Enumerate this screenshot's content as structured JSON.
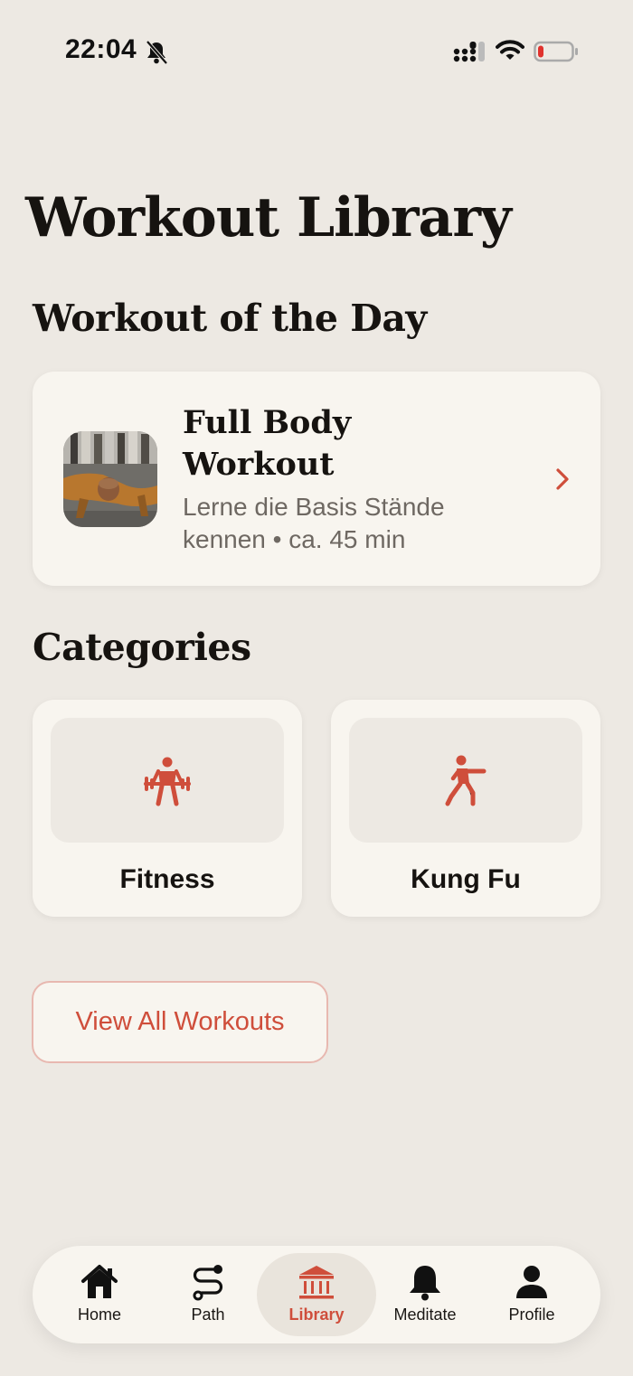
{
  "status_bar": {
    "time": "22:04"
  },
  "page": {
    "title": "Workout Library"
  },
  "workout_of_day": {
    "section_title": "Workout of the Day",
    "title": "Full Body Workout",
    "subtitle": "Lerne die Basis Stände kennen • ca. 45 min"
  },
  "categories": {
    "section_title": "Categories",
    "items": [
      {
        "label": "Fitness",
        "icon": "weightlifter-icon"
      },
      {
        "label": "Kung Fu",
        "icon": "martial-arts-icon"
      }
    ]
  },
  "view_all": {
    "label": "View All Workouts"
  },
  "tabbar": {
    "active": "Library",
    "items": [
      {
        "label": "Home",
        "icon": "home-icon"
      },
      {
        "label": "Path",
        "icon": "path-icon"
      },
      {
        "label": "Library",
        "icon": "library-icon"
      },
      {
        "label": "Meditate",
        "icon": "bell-icon"
      },
      {
        "label": "Profile",
        "icon": "person-icon"
      }
    ]
  },
  "colors": {
    "background": "#ede9e3",
    "card": "#f8f5ef",
    "accent": "#cf4e3b",
    "text": "#161310",
    "muted": "#6e6862"
  }
}
